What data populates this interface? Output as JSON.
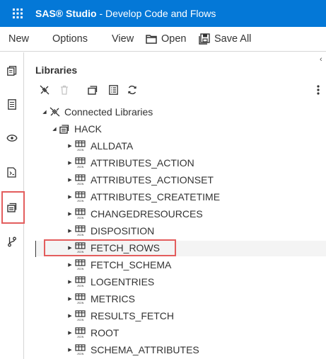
{
  "app": {
    "brand": "SAS® Studio",
    "subtitle": "- Develop Code and Flows",
    "accent_color": "#0478d7",
    "apps_icon": "app-grid-icon"
  },
  "menu": {
    "new": "New",
    "options": "Options",
    "view": "View",
    "open": "Open",
    "save_all": "Save All"
  },
  "nav": {
    "icons": [
      "open-item-icon",
      "explorer-icon",
      "steps-icon",
      "snippets-icon",
      "libraries-icon",
      "git-icon"
    ],
    "selected": "libraries-icon",
    "highlight_color": "#e35d5d"
  },
  "panel": {
    "title": "Libraries",
    "toolbar": [
      "disconnect-icon",
      "delete-icon",
      "new-library-icon",
      "properties-icon",
      "refresh-icon",
      "more-options-icon"
    ]
  },
  "tree": {
    "root": {
      "label": "Connected Libraries",
      "icon": "disconnect-icon",
      "expanded": true
    },
    "library": {
      "label": "HACK",
      "icon": "library-icon",
      "expanded": true
    },
    "tables": [
      {
        "label": "ALLDATA",
        "icon": "json-table-icon"
      },
      {
        "label": "ATTRIBUTES_ACTION",
        "icon": "json-table-icon"
      },
      {
        "label": "ATTRIBUTES_ACTIONSET",
        "icon": "json-table-icon"
      },
      {
        "label": "ATTRIBUTES_CREATETIME",
        "icon": "json-table-icon"
      },
      {
        "label": "CHANGEDRESOURCES",
        "icon": "json-table-icon"
      },
      {
        "label": "DISPOSITION",
        "icon": "json-table-icon"
      },
      {
        "label": "FETCH_ROWS",
        "icon": "json-table-icon"
      },
      {
        "label": "FETCH_SCHEMA",
        "icon": "json-table-icon"
      },
      {
        "label": "LOGENTRIES",
        "icon": "json-table-icon"
      },
      {
        "label": "METRICS",
        "icon": "json-table-icon"
      },
      {
        "label": "RESULTS_FETCH",
        "icon": "json-table-icon"
      },
      {
        "label": "ROOT",
        "icon": "json-table-icon"
      },
      {
        "label": "SCHEMA_ATTRIBUTES",
        "icon": "json-table-icon"
      }
    ],
    "highlighted": "FETCH_ROWS"
  }
}
